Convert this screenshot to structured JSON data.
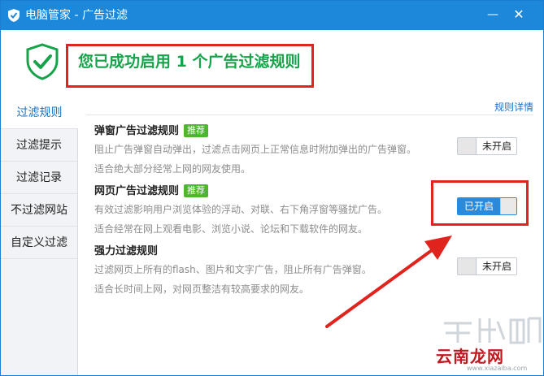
{
  "window": {
    "title": "电脑管家 - 广告过滤",
    "minimize_glyph": "—",
    "close_glyph": "✕",
    "accent": "#1d88da"
  },
  "banner": {
    "message": "您已成功启用 1 个广告过滤规则",
    "icon": "shield-check-icon",
    "message_color": "#16a34a"
  },
  "sidebar": {
    "tabs": [
      {
        "label": "过滤规则",
        "active": true
      },
      {
        "label": "过滤提示",
        "active": false
      },
      {
        "label": "过滤记录",
        "active": false
      },
      {
        "label": "不过滤网站",
        "active": false
      },
      {
        "label": "自定义过滤",
        "active": false
      }
    ]
  },
  "content": {
    "detail_link": "规则详情",
    "rules": [
      {
        "name": "弹窗广告过滤规则",
        "badge": "推荐",
        "desc1": "阻止广告弹窗自动弹出，过滤点击网页上正常信息时附加弹出的广告弹窗。",
        "desc2": "适合绝大部分经常上网的网友使用。",
        "toggle_label": "未开启",
        "enabled": false
      },
      {
        "name": "网页广告过滤规则",
        "badge": "推荐",
        "desc1": "有效过滤影响用户浏览体验的浮动、对联、右下角浮窗等骚扰广告。",
        "desc2": "适合经常在网上观看电影、浏览小说、论坛和下载软件的网友。",
        "toggle_label": "已开启",
        "enabled": true
      },
      {
        "name": "强力过滤规则",
        "badge": "",
        "desc1": "过滤网页上所有的flash、图片和文字广告，阻止所有广告弹窗。",
        "desc2": "适合长时间上网，对网页整洁有较高要求的网友。",
        "toggle_label": "未开启",
        "enabled": false
      }
    ]
  },
  "watermark": {
    "text": "云南龙网",
    "url": "www.xiazaiba.com"
  },
  "annotation_color": "#e0231c"
}
